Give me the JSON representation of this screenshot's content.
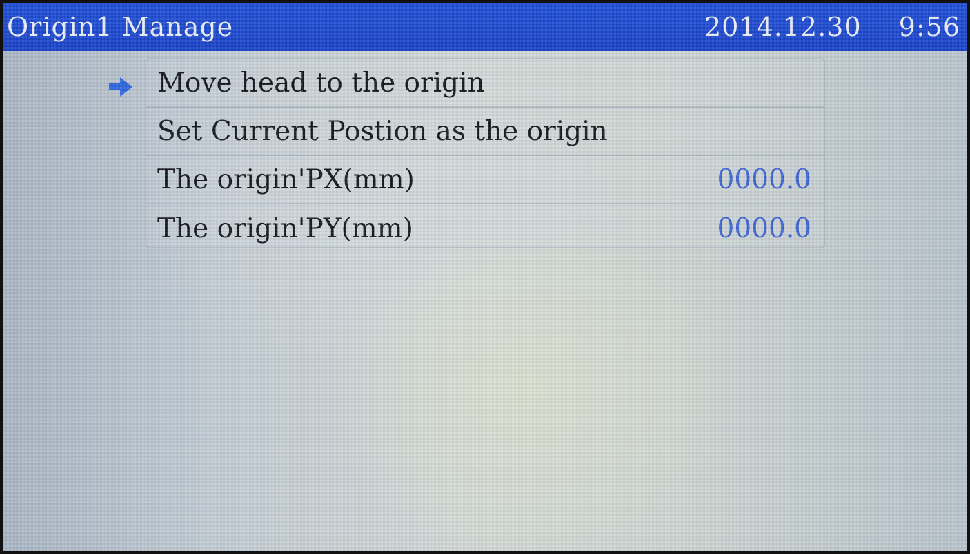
{
  "header": {
    "title": "Origin1 Manage",
    "date": "2014.12.30",
    "time": "9:56"
  },
  "menu": {
    "selected_index": 0,
    "items": [
      {
        "label": "Move head to the origin",
        "value": ""
      },
      {
        "label": "Set Current Postion as the origin",
        "value": ""
      },
      {
        "label": "The origin'PX(mm)",
        "value": "0000.0"
      },
      {
        "label": "The origin'PY(mm)",
        "value": "0000.0"
      }
    ]
  },
  "colors": {
    "title_bar": "#1f4fd8",
    "value_text": "#3c63d6",
    "selection_arrow": "#2e67e0"
  },
  "icons": {
    "selection": "arrow-right-icon"
  }
}
